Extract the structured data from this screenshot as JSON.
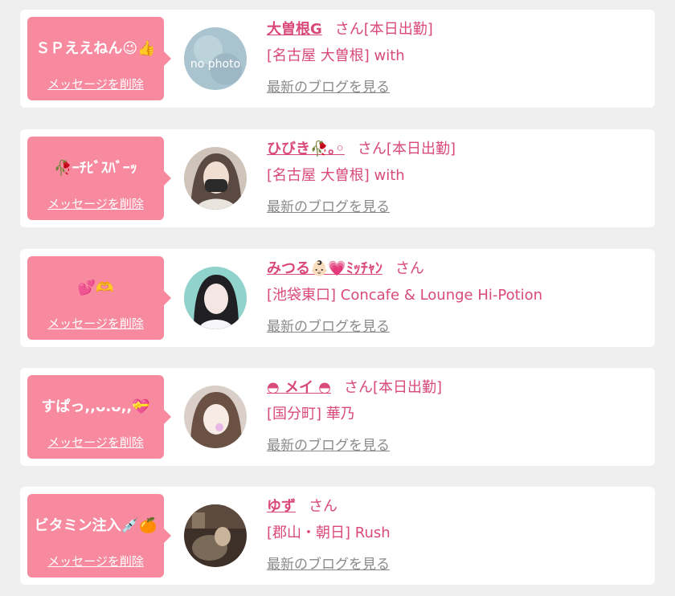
{
  "icons": {
    "delete_link_style": "underline"
  },
  "colors": {
    "accent": "#d94a78",
    "bubble": "#f88aa0",
    "card": "#ffffff",
    "background": "#efefef",
    "muted": "#8a8a8a"
  },
  "messages": [
    {
      "bubble_text": "ＳＰええねん😉👍",
      "delete_label": "メッセージを削除",
      "name": "大曽根G",
      "honorific": "さん",
      "shift": "[本日出勤]",
      "shop": "[名古屋 大曽根] with",
      "blog_link": "最新のブログを見る",
      "avatar_text": "no photo"
    },
    {
      "bubble_text": "🥀ｰﾁﾋﾞｽﾊﾞｰｯ",
      "delete_label": "メッセージを削除",
      "name": "ひびき🥀｡◦",
      "honorific": "さん",
      "shift": "[本日出勤]",
      "shop": "[名古屋 大曽根] with",
      "blog_link": "最新のブログを見る"
    },
    {
      "bubble_text": "💕🫶",
      "delete_label": "メッセージを削除",
      "name": "みつる👶🏻💗ﾐｯﾁｬﾝ",
      "honorific": "さん",
      "shift": "",
      "shop": "[池袋東口] Concafe & Lounge Hi-Potion",
      "blog_link": "最新のブログを見る"
    },
    {
      "bubble_text": "すぱっ,,ᴗ.ᴗ,,💝",
      "delete_label": "メッセージを削除",
      "name": "◓ メイ ◓",
      "honorific": "さん",
      "shift": "[本日出勤]",
      "shop": "[国分町] 華乃",
      "blog_link": "最新のブログを見る"
    },
    {
      "bubble_text": "ビタミン注入💉🍊",
      "delete_label": "メッセージを削除",
      "name": "ゆず",
      "honorific": "さん",
      "shift": "",
      "shop": "[郡山・朝日] Rush",
      "blog_link": "最新のブログを見る"
    }
  ]
}
